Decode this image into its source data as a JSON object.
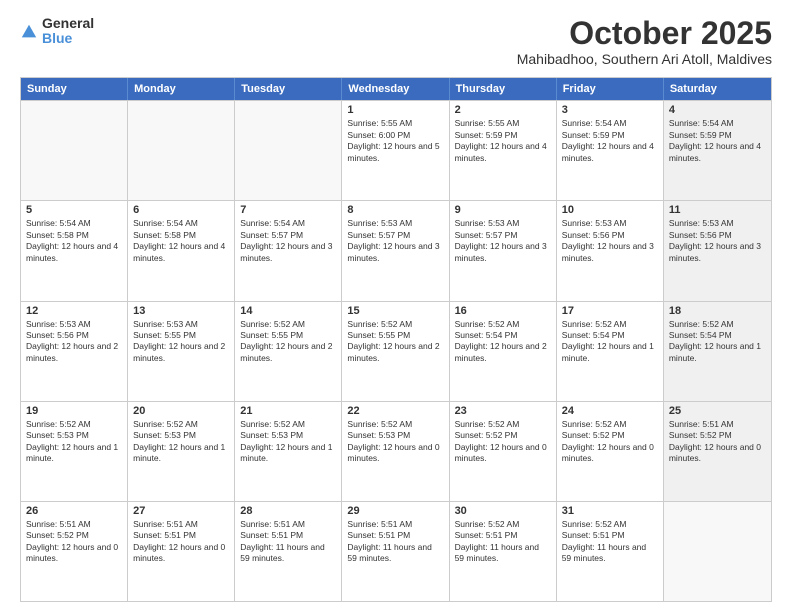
{
  "logo": {
    "general": "General",
    "blue": "Blue"
  },
  "header": {
    "month": "October 2025",
    "location": "Mahibadhoo, Southern Ari Atoll, Maldives"
  },
  "weekdays": [
    "Sunday",
    "Monday",
    "Tuesday",
    "Wednesday",
    "Thursday",
    "Friday",
    "Saturday"
  ],
  "rows": [
    [
      {
        "day": "",
        "empty": true
      },
      {
        "day": "",
        "empty": true
      },
      {
        "day": "",
        "empty": true
      },
      {
        "day": "1",
        "sunrise": "Sunrise: 5:55 AM",
        "sunset": "Sunset: 6:00 PM",
        "daylight": "Daylight: 12 hours and 5 minutes."
      },
      {
        "day": "2",
        "sunrise": "Sunrise: 5:55 AM",
        "sunset": "Sunset: 5:59 PM",
        "daylight": "Daylight: 12 hours and 4 minutes."
      },
      {
        "day": "3",
        "sunrise": "Sunrise: 5:54 AM",
        "sunset": "Sunset: 5:59 PM",
        "daylight": "Daylight: 12 hours and 4 minutes."
      },
      {
        "day": "4",
        "sunrise": "Sunrise: 5:54 AM",
        "sunset": "Sunset: 5:59 PM",
        "daylight": "Daylight: 12 hours and 4 minutes.",
        "shaded": true
      }
    ],
    [
      {
        "day": "5",
        "sunrise": "Sunrise: 5:54 AM",
        "sunset": "Sunset: 5:58 PM",
        "daylight": "Daylight: 12 hours and 4 minutes."
      },
      {
        "day": "6",
        "sunrise": "Sunrise: 5:54 AM",
        "sunset": "Sunset: 5:58 PM",
        "daylight": "Daylight: 12 hours and 4 minutes."
      },
      {
        "day": "7",
        "sunrise": "Sunrise: 5:54 AM",
        "sunset": "Sunset: 5:57 PM",
        "daylight": "Daylight: 12 hours and 3 minutes."
      },
      {
        "day": "8",
        "sunrise": "Sunrise: 5:53 AM",
        "sunset": "Sunset: 5:57 PM",
        "daylight": "Daylight: 12 hours and 3 minutes."
      },
      {
        "day": "9",
        "sunrise": "Sunrise: 5:53 AM",
        "sunset": "Sunset: 5:57 PM",
        "daylight": "Daylight: 12 hours and 3 minutes."
      },
      {
        "day": "10",
        "sunrise": "Sunrise: 5:53 AM",
        "sunset": "Sunset: 5:56 PM",
        "daylight": "Daylight: 12 hours and 3 minutes."
      },
      {
        "day": "11",
        "sunrise": "Sunrise: 5:53 AM",
        "sunset": "Sunset: 5:56 PM",
        "daylight": "Daylight: 12 hours and 3 minutes.",
        "shaded": true
      }
    ],
    [
      {
        "day": "12",
        "sunrise": "Sunrise: 5:53 AM",
        "sunset": "Sunset: 5:56 PM",
        "daylight": "Daylight: 12 hours and 2 minutes."
      },
      {
        "day": "13",
        "sunrise": "Sunrise: 5:53 AM",
        "sunset": "Sunset: 5:55 PM",
        "daylight": "Daylight: 12 hours and 2 minutes."
      },
      {
        "day": "14",
        "sunrise": "Sunrise: 5:52 AM",
        "sunset": "Sunset: 5:55 PM",
        "daylight": "Daylight: 12 hours and 2 minutes."
      },
      {
        "day": "15",
        "sunrise": "Sunrise: 5:52 AM",
        "sunset": "Sunset: 5:55 PM",
        "daylight": "Daylight: 12 hours and 2 minutes."
      },
      {
        "day": "16",
        "sunrise": "Sunrise: 5:52 AM",
        "sunset": "Sunset: 5:54 PM",
        "daylight": "Daylight: 12 hours and 2 minutes."
      },
      {
        "day": "17",
        "sunrise": "Sunrise: 5:52 AM",
        "sunset": "Sunset: 5:54 PM",
        "daylight": "Daylight: 12 hours and 1 minute."
      },
      {
        "day": "18",
        "sunrise": "Sunrise: 5:52 AM",
        "sunset": "Sunset: 5:54 PM",
        "daylight": "Daylight: 12 hours and 1 minute.",
        "shaded": true
      }
    ],
    [
      {
        "day": "19",
        "sunrise": "Sunrise: 5:52 AM",
        "sunset": "Sunset: 5:53 PM",
        "daylight": "Daylight: 12 hours and 1 minute."
      },
      {
        "day": "20",
        "sunrise": "Sunrise: 5:52 AM",
        "sunset": "Sunset: 5:53 PM",
        "daylight": "Daylight: 12 hours and 1 minute."
      },
      {
        "day": "21",
        "sunrise": "Sunrise: 5:52 AM",
        "sunset": "Sunset: 5:53 PM",
        "daylight": "Daylight: 12 hours and 1 minute."
      },
      {
        "day": "22",
        "sunrise": "Sunrise: 5:52 AM",
        "sunset": "Sunset: 5:53 PM",
        "daylight": "Daylight: 12 hours and 0 minutes."
      },
      {
        "day": "23",
        "sunrise": "Sunrise: 5:52 AM",
        "sunset": "Sunset: 5:52 PM",
        "daylight": "Daylight: 12 hours and 0 minutes."
      },
      {
        "day": "24",
        "sunrise": "Sunrise: 5:52 AM",
        "sunset": "Sunset: 5:52 PM",
        "daylight": "Daylight: 12 hours and 0 minutes."
      },
      {
        "day": "25",
        "sunrise": "Sunrise: 5:51 AM",
        "sunset": "Sunset: 5:52 PM",
        "daylight": "Daylight: 12 hours and 0 minutes.",
        "shaded": true
      }
    ],
    [
      {
        "day": "26",
        "sunrise": "Sunrise: 5:51 AM",
        "sunset": "Sunset: 5:52 PM",
        "daylight": "Daylight: 12 hours and 0 minutes."
      },
      {
        "day": "27",
        "sunrise": "Sunrise: 5:51 AM",
        "sunset": "Sunset: 5:51 PM",
        "daylight": "Daylight: 12 hours and 0 minutes."
      },
      {
        "day": "28",
        "sunrise": "Sunrise: 5:51 AM",
        "sunset": "Sunset: 5:51 PM",
        "daylight": "Daylight: 11 hours and 59 minutes."
      },
      {
        "day": "29",
        "sunrise": "Sunrise: 5:51 AM",
        "sunset": "Sunset: 5:51 PM",
        "daylight": "Daylight: 11 hours and 59 minutes."
      },
      {
        "day": "30",
        "sunrise": "Sunrise: 5:52 AM",
        "sunset": "Sunset: 5:51 PM",
        "daylight": "Daylight: 11 hours and 59 minutes."
      },
      {
        "day": "31",
        "sunrise": "Sunrise: 5:52 AM",
        "sunset": "Sunset: 5:51 PM",
        "daylight": "Daylight: 11 hours and 59 minutes."
      },
      {
        "day": "",
        "empty": true,
        "shaded": true
      }
    ]
  ]
}
